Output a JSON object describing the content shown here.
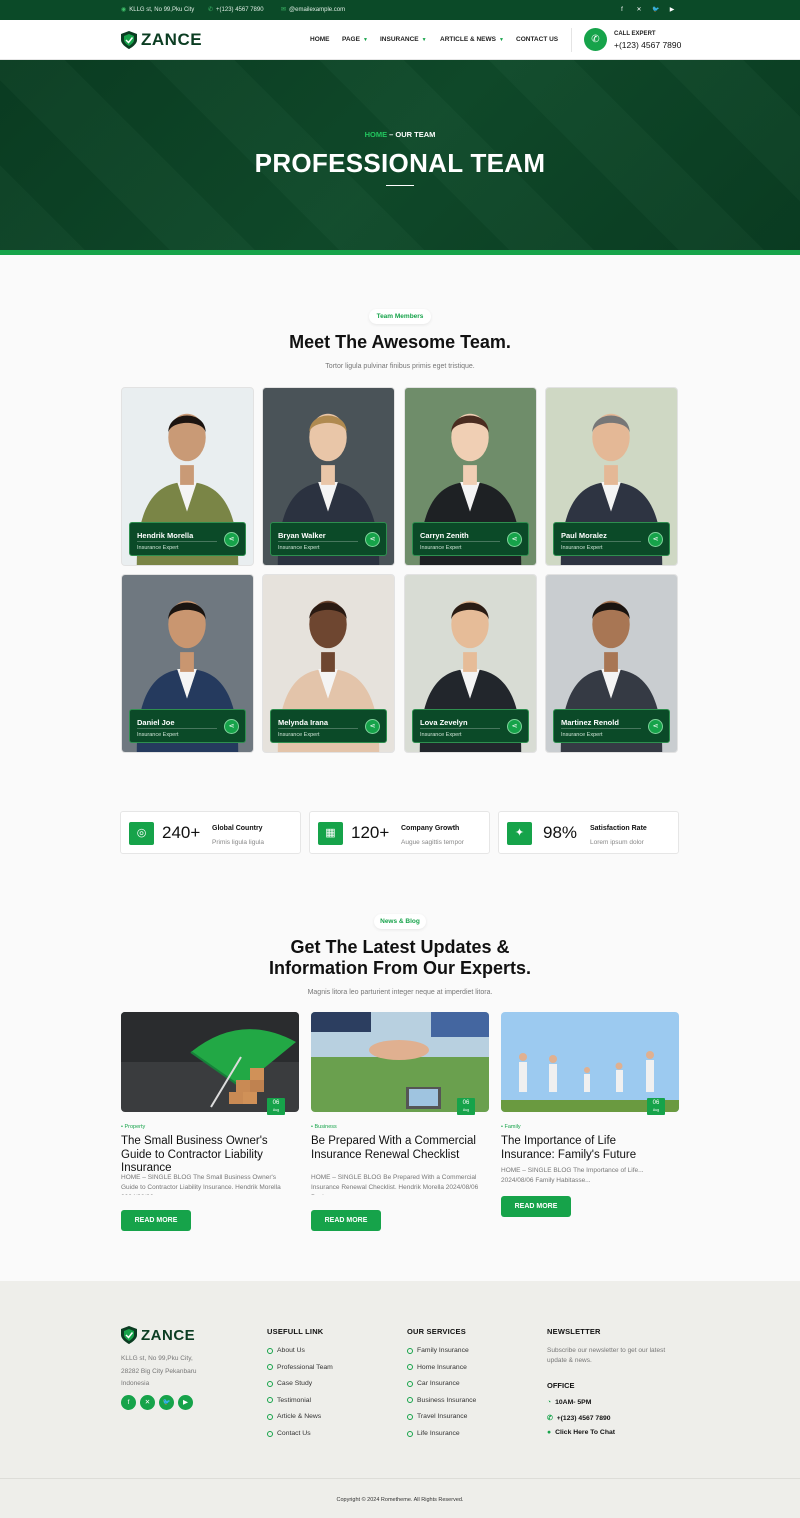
{
  "topbar": {
    "address": "KLLG st, No 99,Pku City",
    "phone": "+(123) 4567 7890",
    "email": "@emailexample.com",
    "social_icons": [
      "facebook-icon",
      "x-icon",
      "twitter-icon",
      "youtube-icon"
    ]
  },
  "brand": {
    "name": "ZANCE",
    "color": "#0b3d22",
    "accent": "#16a34a"
  },
  "nav": {
    "items": [
      "HOME",
      "PAGE",
      "INSURANCE",
      "ARTICLE & NEWS",
      "CONTACT US"
    ],
    "call_label": "CALL EXPERT",
    "call_number": "+(123) 4567 7890"
  },
  "hero": {
    "crumb_home": "HOME",
    "crumb_sep": " – ",
    "crumb_current": "OUR TEAM",
    "title": "PROFESSIONAL TEAM"
  },
  "team": {
    "pill": "Team Members",
    "title": "Meet The Awesome Team.",
    "subtitle": "Tortor ligula pulvinar finibus primis eget tristique.",
    "members": [
      {
        "name": "Hendrik Morella",
        "role": "Insurance Expert"
      },
      {
        "name": "Bryan Walker",
        "role": "Insurance Expert"
      },
      {
        "name": "Carryn Zenith",
        "role": "Insurance Expert"
      },
      {
        "name": "Paul Moralez",
        "role": "Insurance Expert"
      },
      {
        "name": "Daniel Joe",
        "role": "Insurance Expert"
      },
      {
        "name": "Melynda Irana",
        "role": "Insurance Expert"
      },
      {
        "name": "Lova Zevelyn",
        "role": "Insurance Expert"
      },
      {
        "name": "Martinez Renold",
        "role": "Insurance Expert"
      }
    ]
  },
  "stats": [
    {
      "value": "240+",
      "label": "Global Country",
      "sub": "Primis ligula ligula"
    },
    {
      "value": "120+",
      "label": "Company Growth",
      "sub": "Augue sagittis tempor"
    },
    {
      "value": "98%",
      "label": "Satisfaction Rate",
      "sub": "Lorem ipsum dolor"
    }
  ],
  "blog": {
    "pill": "News & Blog",
    "title_line1": "Get The Latest Updates &",
    "title_line2": "Information From Our Experts.",
    "subtitle": "Magnis litora leo parturient integer neque at imperdiet litora.",
    "read_more": "READ MORE",
    "posts": [
      {
        "category": "Property",
        "day": "06",
        "month": "Aug",
        "title": "The Small Business Owner's Guide to Contractor Liability Insurance",
        "excerpt": "HOME – SINGLE BLOG The Small Business Owner's Guide to Contractor Liability Insurance. Hendrik Morella 2024/08/06..."
      },
      {
        "category": "Business",
        "day": "06",
        "month": "Aug",
        "title": "Be Prepared With a Commercial Insurance Renewal Checklist",
        "excerpt": "HOME – SINGLE BLOG Be Prepared With a Commercial Insurance Renewal Checklist. Hendrik Morella 2024/08/06 Business..."
      },
      {
        "category": "Family",
        "day": "06",
        "month": "Aug",
        "title": "The Importance of Life Insurance: Family's Future",
        "excerpt": "HOME – SINGLE BLOG The Importance of Life... 2024/08/06 Family Habitasse..."
      }
    ]
  },
  "footer": {
    "address_line1": "KLLG st, No 99,Pku City,",
    "address_line2": "28282 Big City Pekanbaru",
    "address_line3": "Indonesia",
    "useful_title": "USEFULL LINK",
    "useful": [
      "About Us",
      "Professional Team",
      "Case Study",
      "Testimonial",
      "Article & News",
      "Contact Us"
    ],
    "services_title": "OUR SERVICES",
    "services": [
      "Family Insurance",
      "Home Insurance",
      "Car Insurance",
      "Business Insurance",
      "Travel Insurance",
      "Life Insurance"
    ],
    "newsletter_title": "NEWSLETTER",
    "newsletter_text": "Subscribe our newsletter to get our latest update & news.",
    "office_title": "OFFICE",
    "office_hours": "10AM- 5PM",
    "office_phone": "+(123) 4567 7890",
    "office_chat": "Click Here To Chat",
    "copyright": "Copyright © 2024 Rometheme. All Rights Reserved."
  }
}
